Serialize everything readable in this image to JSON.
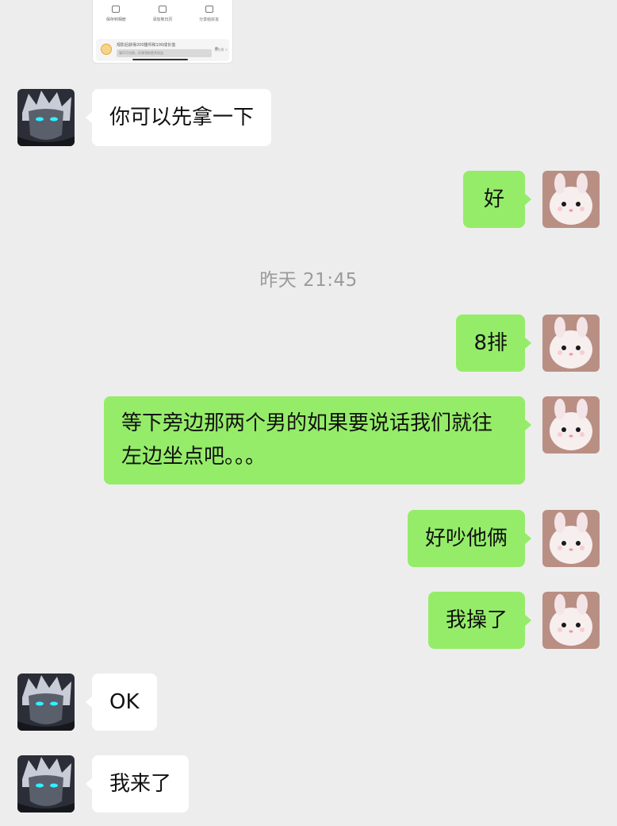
{
  "shared_card": {
    "actions": [
      {
        "label": "保存到相册",
        "icon": "download-icon"
      },
      {
        "label": "添加到日历",
        "icon": "calendar-icon"
      },
      {
        "label": "分享给好友",
        "icon": "share-icon"
      }
    ],
    "promo_text": "观影后获得200猫币和100成长值",
    "promo_sub": "猫币可兑换，好课领取更多权益",
    "promo_tail": "去兑换 >"
  },
  "timestamp": "昨天 21:45",
  "messages": [
    {
      "side": "left",
      "sender": "contact",
      "text": "你可以先拿一下"
    },
    {
      "side": "right",
      "sender": "me",
      "text": "好"
    },
    {
      "side": "right",
      "sender": "me",
      "text": "8排"
    },
    {
      "side": "right",
      "sender": "me",
      "text": "等下旁边那两个男的如果要说话我们就往左边坐点吧。。。"
    },
    {
      "side": "right",
      "sender": "me",
      "text": "好吵他俩"
    },
    {
      "side": "right",
      "sender": "me",
      "text": "我操了"
    },
    {
      "side": "left",
      "sender": "contact",
      "text": "OK"
    },
    {
      "side": "left",
      "sender": "contact",
      "text": "我来了"
    }
  ],
  "colors": {
    "background": "#ededed",
    "bubble_left": "#ffffff",
    "bubble_right": "#95ec69",
    "timestamp": "#9b9b9b"
  }
}
